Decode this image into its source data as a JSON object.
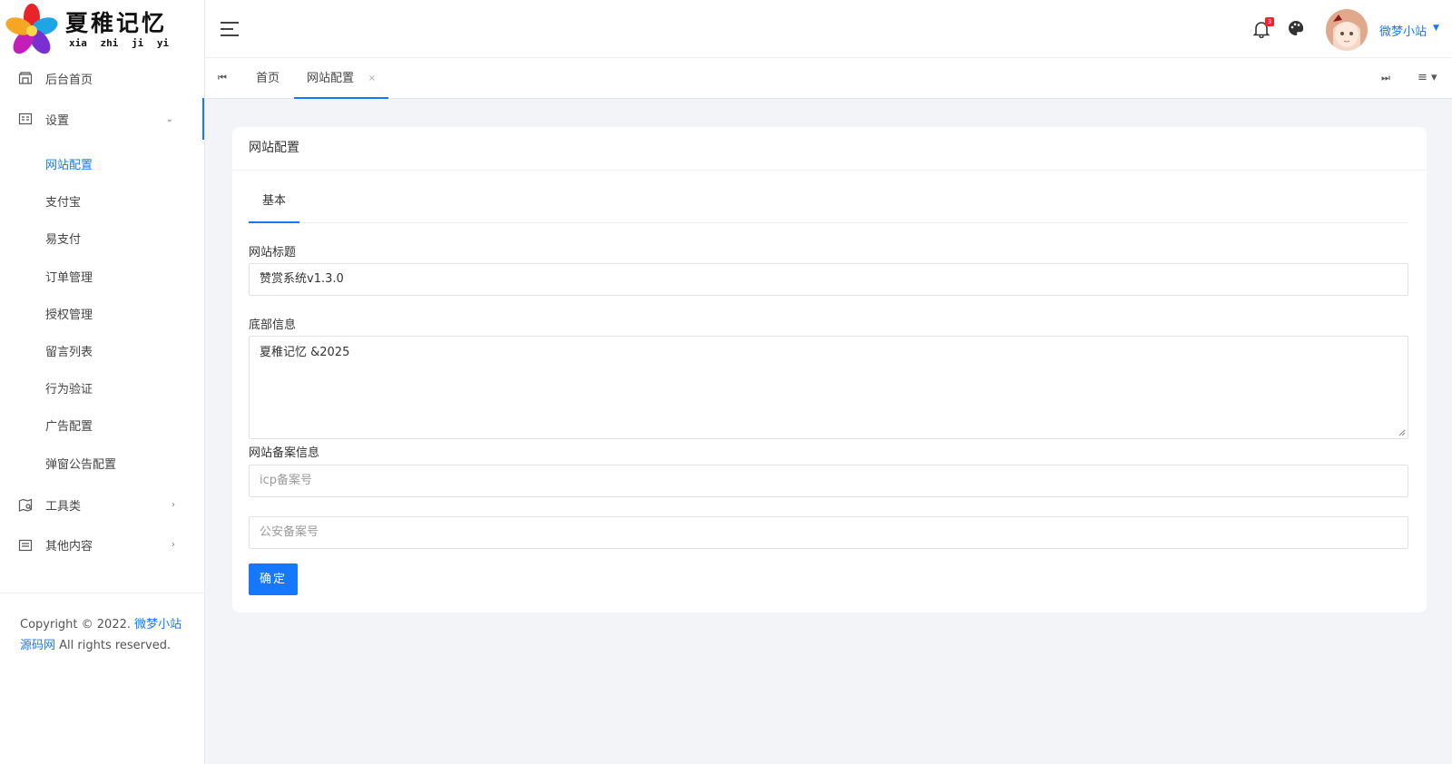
{
  "logo": {
    "title_cn": "夏稚记忆",
    "pinyin": "xia zhi ji yi"
  },
  "sidebar": {
    "items": [
      {
        "label": "后台首页",
        "icon": "dashboard-icon"
      },
      {
        "label": "设置",
        "icon": "settings-panel-icon"
      },
      {
        "label": "工具类",
        "icon": "map-icon"
      },
      {
        "label": "其他内容",
        "icon": "list-icon"
      }
    ],
    "sub_items": [
      "网站配置",
      "支付宝",
      "易支付",
      "订单管理",
      "授权管理",
      "留言列表",
      "行为验证",
      "广告配置",
      "弹窗公告配置"
    ],
    "copyright_prefix": "Copyright © 2022. ",
    "copyright_link": "微梦小站源码网",
    "copyright_suffix": " All rights reserved."
  },
  "header": {
    "notification_count": "3",
    "user_name": "微梦小站"
  },
  "tabs": {
    "home": "首页",
    "current": "网站配置",
    "close": "×"
  },
  "card": {
    "title": "网站配置",
    "tab_basic": "基本",
    "site_title_label": "网站标题",
    "site_title_value": "赞赏系统v1.3.0",
    "footer_label": "底部信息",
    "footer_value": "夏稚记忆 &2025",
    "icp_label": "网站备案信息",
    "icp_placeholder": "icp备案号",
    "police_placeholder": "公安备案号",
    "submit": "确定"
  },
  "colors": {
    "accent": "#1677ff",
    "badge": "#f5222d"
  }
}
